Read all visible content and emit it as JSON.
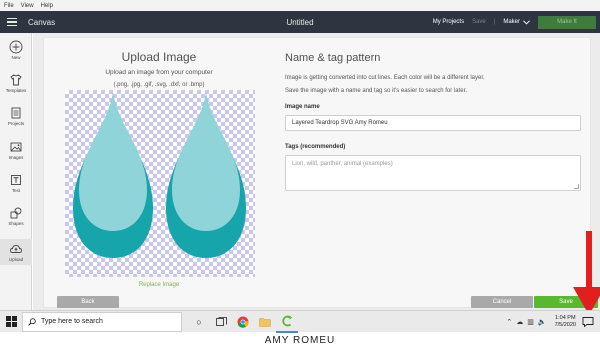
{
  "menubar": {
    "items": [
      "File",
      "View",
      "Help"
    ]
  },
  "topbar": {
    "app_title": "Canvas",
    "document_title": "Untitled",
    "my_projects": "My Projects",
    "save": "Save",
    "separator": "|",
    "machine": "Maker",
    "make_it": "Make It"
  },
  "sidebar": {
    "items": [
      {
        "label": "New",
        "icon": "plus-icon"
      },
      {
        "label": "Templates",
        "icon": "shirt-icon"
      },
      {
        "label": "Projects",
        "icon": "projects-icon"
      },
      {
        "label": "Images",
        "icon": "image-icon"
      },
      {
        "label": "Text",
        "icon": "text-icon"
      },
      {
        "label": "Shapes",
        "icon": "shapes-icon"
      },
      {
        "label": "Upload",
        "icon": "cloud-upload-icon"
      }
    ]
  },
  "upload": {
    "title": "Upload Image",
    "subtitle": "Upload an image from your computer",
    "file_types": "(.png, .jpg, .gif, .svg, .dxf, or .bmp)",
    "replace_link": "Replace Image"
  },
  "form": {
    "title": "Name & tag pattern",
    "description1": "Image is getting converted into cut lines. Each color will be a different layer.",
    "description2": "Save the image with a name and tag so it's easier to search for later.",
    "name_label": "Image name",
    "name_value": "Layered Teardrop SVG Amy Romeu",
    "tags_label": "Tags (recommended)",
    "tags_placeholder": "Lion, wild, panther, animal (examples)"
  },
  "buttons": {
    "back": "Back",
    "cancel": "Cancel",
    "save": "Save"
  },
  "colors": {
    "teal_dark": "#16a5aa",
    "teal_light": "#8ed4d8",
    "save_green": "#58b82f",
    "arrow_red": "#e31e1e",
    "topbar": "#2f3540"
  },
  "taskbar": {
    "search_placeholder": "Type here to search",
    "time": "1:04 PM",
    "date": "7/5/2020"
  },
  "watermark": "AMY ROMEU"
}
